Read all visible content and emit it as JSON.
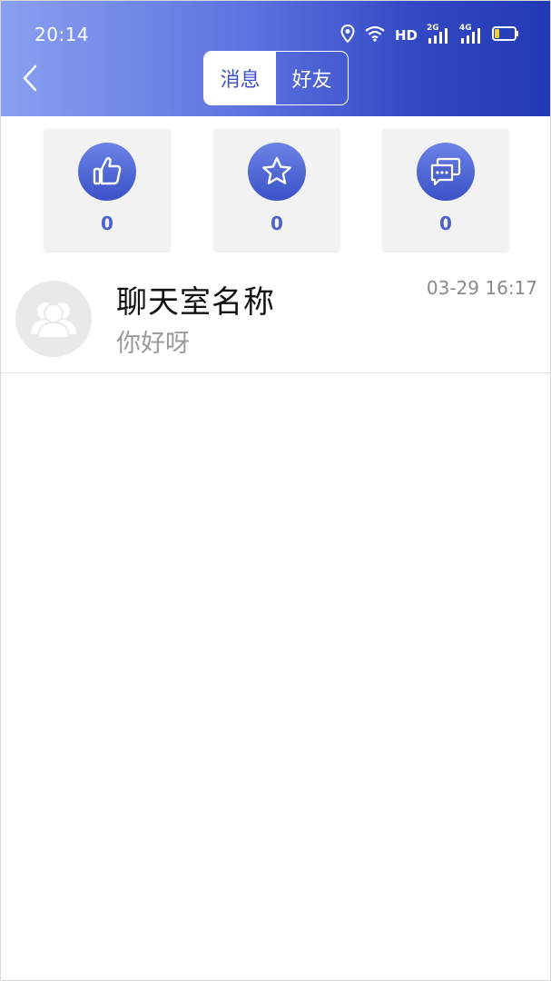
{
  "status_bar": {
    "time": "20:14",
    "hd_label": "HD",
    "network_2g": "2G",
    "network_4g": "4G",
    "battery_color": "#f5d23a"
  },
  "header": {
    "tabs": [
      {
        "label": "消息",
        "active": true
      },
      {
        "label": "好友",
        "active": false
      }
    ],
    "colors": {
      "accent": "#3b50c8",
      "gradient_start": "#8aa0f0",
      "gradient_end": "#2239b4"
    }
  },
  "stats": [
    {
      "icon": "thumbs-up-icon",
      "count": "0"
    },
    {
      "icon": "star-icon",
      "count": "0"
    },
    {
      "icon": "chat-bubbles-icon",
      "count": "0"
    }
  ],
  "chats": [
    {
      "name": "聊天室名称",
      "preview": "你好呀",
      "time": "03-29 16:17",
      "avatar_icon": "group-avatar-icon"
    }
  ]
}
